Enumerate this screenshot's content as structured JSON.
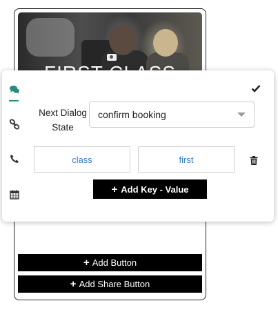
{
  "card": {
    "hero_title": "FIRST CLASS",
    "add_button_label": "Add Button",
    "add_share_button_label": "Add Share Button"
  },
  "sidebar": {
    "items": [
      {
        "icon": "chat-icon",
        "active": true
      },
      {
        "icon": "link-icon",
        "active": false
      },
      {
        "icon": "phone-icon",
        "active": false
      },
      {
        "icon": "calendar-icon",
        "active": false
      }
    ]
  },
  "editor": {
    "next_state_label_line1": "Next Dialog",
    "next_state_label_line2": "State",
    "next_state_value": "confirm booking",
    "key_value": "class",
    "value_value": "first",
    "add_key_value_label": "Add Key - Value"
  },
  "colors": {
    "accent": "#2a8c7e",
    "link_text": "#3d7cc9",
    "button_bg": "#000000"
  }
}
